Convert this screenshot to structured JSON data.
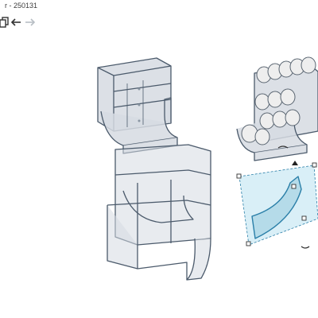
{
  "window": {
    "title": "r - 250131"
  },
  "toolbar": {
    "items": [
      {
        "icon": "copy-icon"
      },
      {
        "icon": "undo-icon"
      },
      {
        "icon": "redo-icon"
      }
    ]
  },
  "scene": {
    "models": [
      {
        "name": "dispenser-small"
      },
      {
        "name": "dispenser-with-eggs"
      },
      {
        "name": "dispenser-frame-large"
      },
      {
        "name": "ramp-part-selected"
      }
    ],
    "colors": {
      "part_fill": "#d6dbe2",
      "part_stroke": "#4b5a6b",
      "selection_fill": "#bfe4f2",
      "selection_stroke": "#2a7fa8",
      "egg_fill": "#eeeeee"
    }
  }
}
